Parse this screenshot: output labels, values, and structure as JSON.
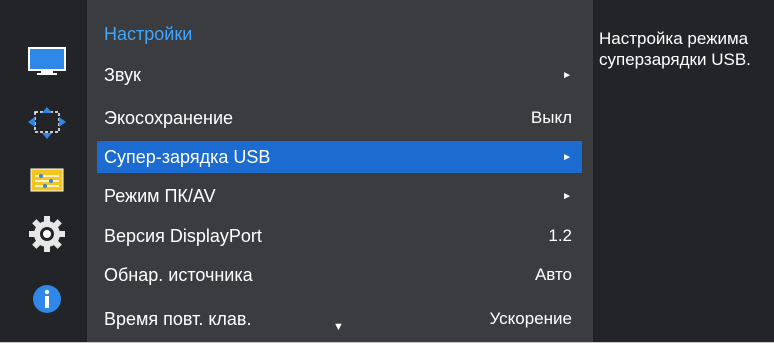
{
  "menu": {
    "title": "Настройки",
    "items": [
      {
        "label": "Звук",
        "value": "►"
      },
      {
        "label": "Экосохранение",
        "value": "Выкл"
      },
      {
        "label": "Супер-зарядка USB",
        "value": "►"
      },
      {
        "label": "Режим ПК/AV",
        "value": "►"
      },
      {
        "label": "Версия DisplayPort",
        "value": "1.2"
      },
      {
        "label": "Обнар. источника",
        "value": "Авто"
      },
      {
        "label": "Время повт. клав.",
        "value": "Ускорение"
      }
    ],
    "selected_index": 2,
    "scroll_indicator": "▼"
  },
  "help": {
    "text": "Настройка режима суперзарядки USB."
  },
  "sidebar": {
    "icons": [
      "picture-icon",
      "onscreen-display-icon",
      "setup-reset-icon",
      "system-gear-icon",
      "information-icon"
    ]
  },
  "colors": {
    "menu_bg": "#3a3c40",
    "sidebar_bg": "#222427",
    "selected_bg": "#1b6bd1",
    "title": "#3ea7ff"
  }
}
